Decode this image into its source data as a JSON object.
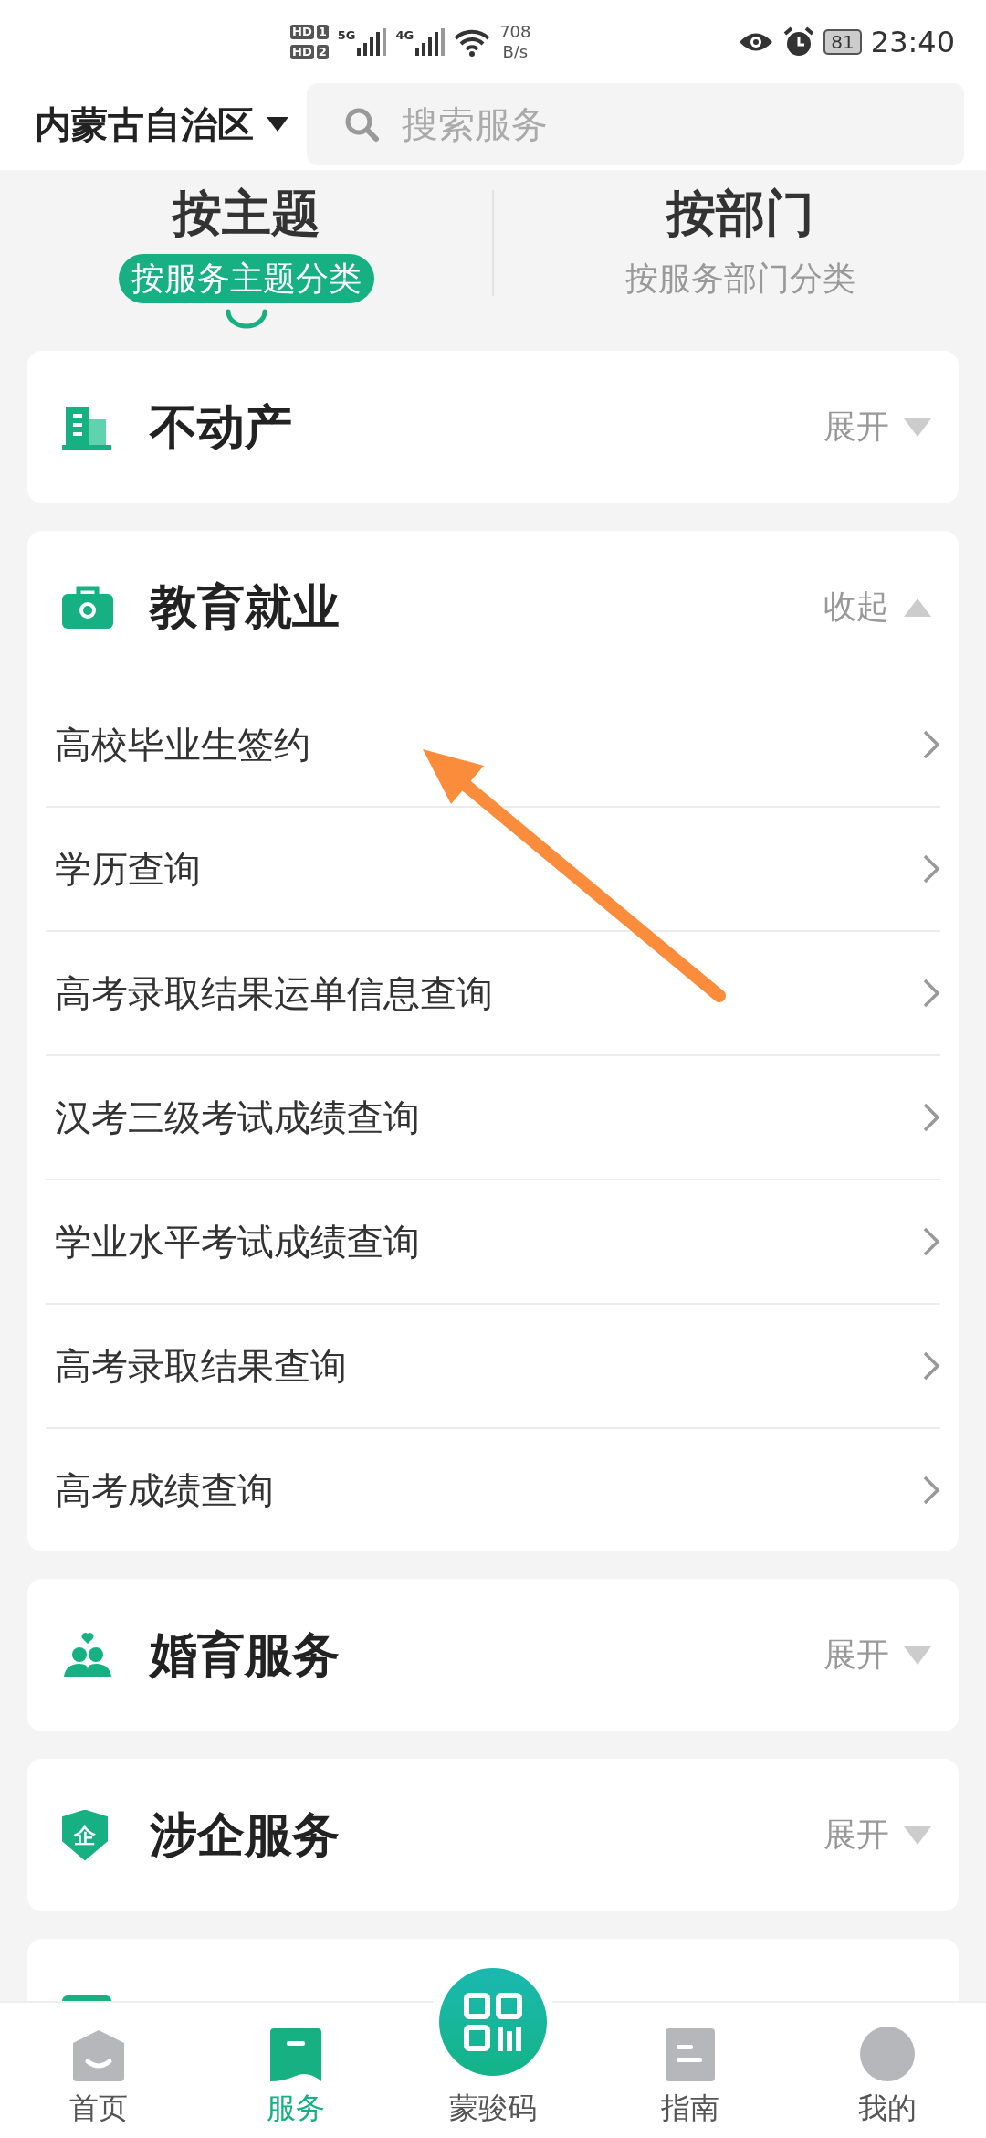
{
  "status_bar": {
    "sims": [
      {
        "label": "HD",
        "slot": "1"
      },
      {
        "label": "HD",
        "slot": "2"
      }
    ],
    "networks": [
      "5G",
      "4G"
    ],
    "speed": "708",
    "speed_unit": "B/s",
    "battery": "81",
    "time": "23:40"
  },
  "header": {
    "region": "内蒙古自治区",
    "search": {
      "placeholder": "搜索服务"
    }
  },
  "tabs": [
    {
      "title": "按主题",
      "subtitle": "按服务主题分类",
      "selected": true
    },
    {
      "title": "按部门",
      "subtitle": "按服务部门分类",
      "selected": false
    }
  ],
  "sections": [
    {
      "title": "不动产",
      "expanded": false,
      "toggle": "展开"
    },
    {
      "title": "教育就业",
      "expanded": true,
      "toggle": "收起",
      "items": [
        "高校毕业生签约",
        "学历查询",
        "高考录取结果运单信息查询",
        "汉考三级考试成绩查询",
        "学业水平考试成绩查询",
        "高考录取结果查询",
        "高考成绩查询"
      ]
    },
    {
      "title": "婚育服务",
      "expanded": false,
      "toggle": "展开"
    },
    {
      "title": "涉企服务",
      "icon_text": "企",
      "expanded": false,
      "toggle": "展开"
    }
  ],
  "nav": [
    {
      "label": "首页",
      "selected": false
    },
    {
      "label": "服务",
      "selected": true
    },
    {
      "label": "蒙骏码",
      "selected": false
    },
    {
      "label": "指南",
      "selected": false
    },
    {
      "label": "我的",
      "selected": false
    }
  ]
}
